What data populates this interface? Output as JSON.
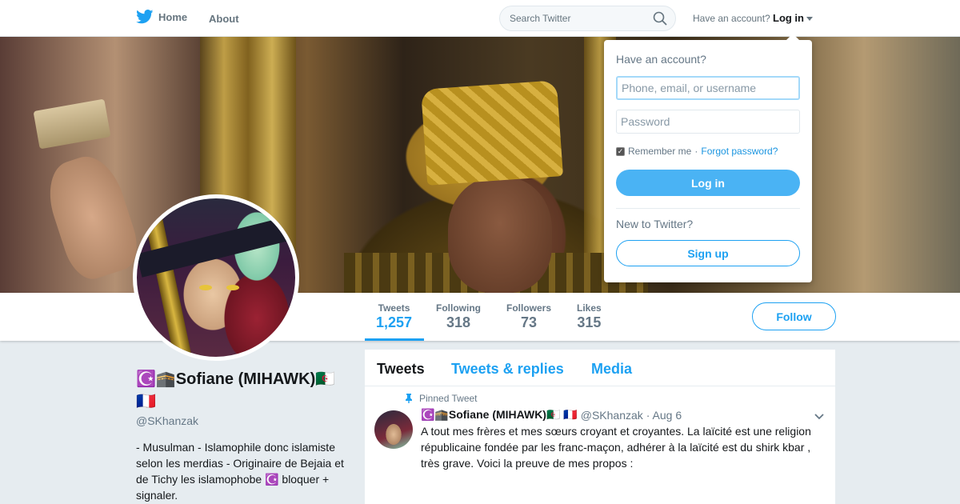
{
  "nav": {
    "home_label": "Home",
    "about_label": "About",
    "search_placeholder": "Search Twitter",
    "have_account": "Have an account?",
    "login_label": "Log in"
  },
  "profile": {
    "name_line": "☪️🕋Sofiane (MIHAWK)🇩🇿 🇫🇷",
    "handle": "@SKhanzak",
    "bio": "- Musulman - Islamophile donc islamiste selon les merdias - Originaire de Bejaia et de Tichy les islamophobe ☪️ bloquer + signaler.",
    "follow_label": "Follow"
  },
  "stats": [
    {
      "label": "Tweets",
      "value": "1,257"
    },
    {
      "label": "Following",
      "value": "318"
    },
    {
      "label": "Followers",
      "value": "73"
    },
    {
      "label": "Likes",
      "value": "315"
    }
  ],
  "timeline": {
    "tabs": [
      "Tweets",
      "Tweets & replies",
      "Media"
    ],
    "pinned_label": "Pinned Tweet",
    "tweet": {
      "name": "☪️🕋Sofiane (MIHAWK)🇩🇿 🇫🇷",
      "handle": "@SKhanzak",
      "date": "· Aug 6",
      "text": "A tout mes frères et mes sœurs croyant et croyantes. La laïcité est une religion républicaine fondée par les franc-maçon,  adhérer à la laïcité est du shirk kbar , très grave. Voici la preuve de mes propos :"
    }
  },
  "login_dropdown": {
    "title": "Have an account?",
    "username_placeholder": "Phone, email, or username",
    "password_placeholder": "Password",
    "remember_label": "Remember me",
    "separator": "·",
    "forgot_label": "Forgot password?",
    "login_button": "Log in",
    "new_label": "New to Twitter?",
    "signup_button": "Sign up"
  },
  "colors": {
    "accent": "#1da1f2",
    "login_button_bg": "#4ab3f4",
    "background": "#e6ecf0"
  }
}
